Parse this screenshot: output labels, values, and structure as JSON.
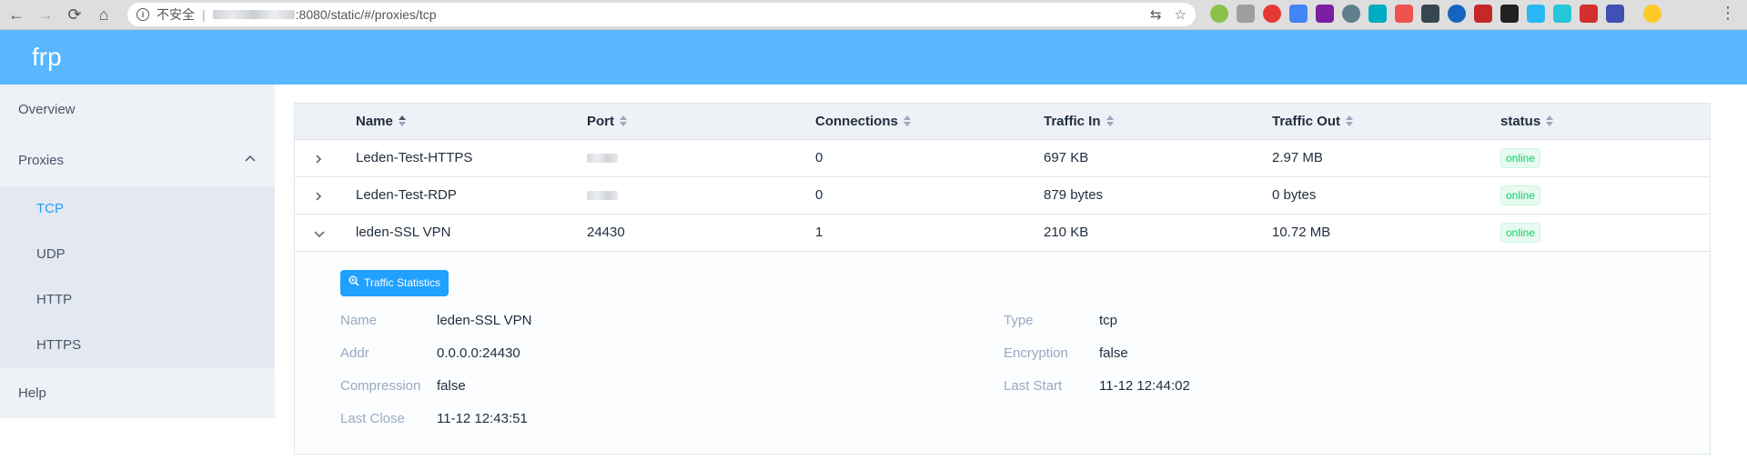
{
  "browser": {
    "insecure_label": "不安全",
    "url_suffix": ":8080/static/#/proxies/tcp"
  },
  "app": {
    "logo": "frp"
  },
  "sidebar": {
    "items": [
      {
        "label": "Overview"
      },
      {
        "label": "Proxies"
      },
      {
        "label": "Help"
      }
    ],
    "proxies_sub": [
      {
        "label": "TCP",
        "active": true
      },
      {
        "label": "UDP"
      },
      {
        "label": "HTTP"
      },
      {
        "label": "HTTPS"
      }
    ]
  },
  "table": {
    "columns": [
      "Name",
      "Port",
      "Connections",
      "Traffic In",
      "Traffic Out",
      "status"
    ],
    "rows": [
      {
        "name": "Leden-Test-HTTPS",
        "port": "",
        "connections": "0",
        "traffic_in": "697 KB",
        "traffic_out": "2.97 MB",
        "status": "online"
      },
      {
        "name": "Leden-Test-RDP",
        "port": "",
        "connections": "0",
        "traffic_in": "879 bytes",
        "traffic_out": "0 bytes",
        "status": "online"
      },
      {
        "name": "leden-SSL VPN",
        "port": "24430",
        "connections": "1",
        "traffic_in": "210 KB",
        "traffic_out": "10.72 MB",
        "status": "online"
      }
    ]
  },
  "details": {
    "stats_button": "Traffic Statistics",
    "fields": {
      "name_label": "Name",
      "name_value": "leden-SSL VPN",
      "type_label": "Type",
      "type_value": "tcp",
      "addr_label": "Addr",
      "addr_value": "0.0.0.0:24430",
      "encryption_label": "Encryption",
      "encryption_value": "false",
      "compression_label": "Compression",
      "compression_value": "false",
      "last_start_label": "Last Start",
      "last_start_value": "11-12 12:44:02",
      "last_close_label": "Last Close",
      "last_close_value": "11-12 12:43:51"
    }
  },
  "colors": {
    "header": "#58b7ff",
    "accent": "#20a0ff",
    "online": "#13ce66"
  }
}
